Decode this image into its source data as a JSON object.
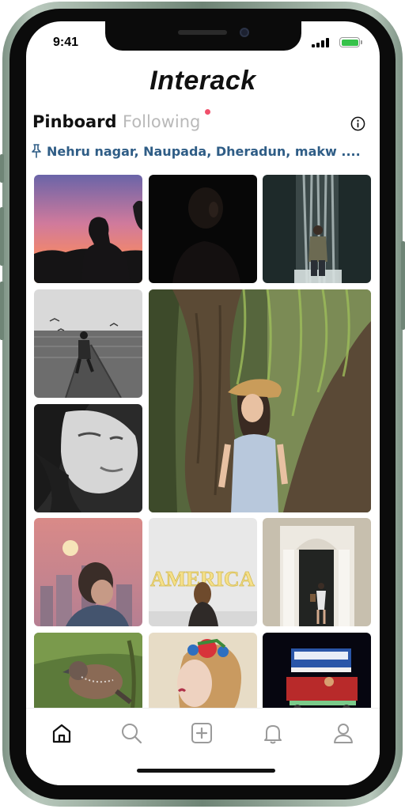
{
  "status_bar": {
    "time": "9:41"
  },
  "app": {
    "title": "Interack"
  },
  "tabs": [
    {
      "label": "Pinboard",
      "active": true
    },
    {
      "label": "Following",
      "active": false,
      "has_notification": true
    }
  ],
  "location": {
    "text": "Nehru nagar, Naupada, Dheradun, makw ....",
    "icon": "pin-icon"
  },
  "colors": {
    "accent": "#2f5d86",
    "notification": "#f0506b",
    "battery": "#36c24a"
  },
  "feed": {
    "tiles": [
      {
        "name": "photo-silhouette-sunset"
      },
      {
        "name": "photo-dark-portrait"
      },
      {
        "name": "photo-waterfall-man"
      },
      {
        "name": "photo-pier-runner"
      },
      {
        "name": "photo-woman-tree-featured"
      },
      {
        "name": "photo-bw-woman-portrait"
      },
      {
        "name": "photo-man-city-sunset"
      },
      {
        "name": "photo-america-sign"
      },
      {
        "name": "photo-woman-door"
      },
      {
        "name": "photo-bird-branch"
      },
      {
        "name": "photo-flower-crown"
      },
      {
        "name": "photo-food-cart-night"
      }
    ]
  },
  "bottom_nav": [
    {
      "icon": "home-icon",
      "active": true
    },
    {
      "icon": "search-icon",
      "active": false
    },
    {
      "icon": "add-post-icon",
      "active": false
    },
    {
      "icon": "bell-icon",
      "active": false
    },
    {
      "icon": "profile-icon",
      "active": false
    }
  ],
  "america_sign_text": "AMERICA"
}
